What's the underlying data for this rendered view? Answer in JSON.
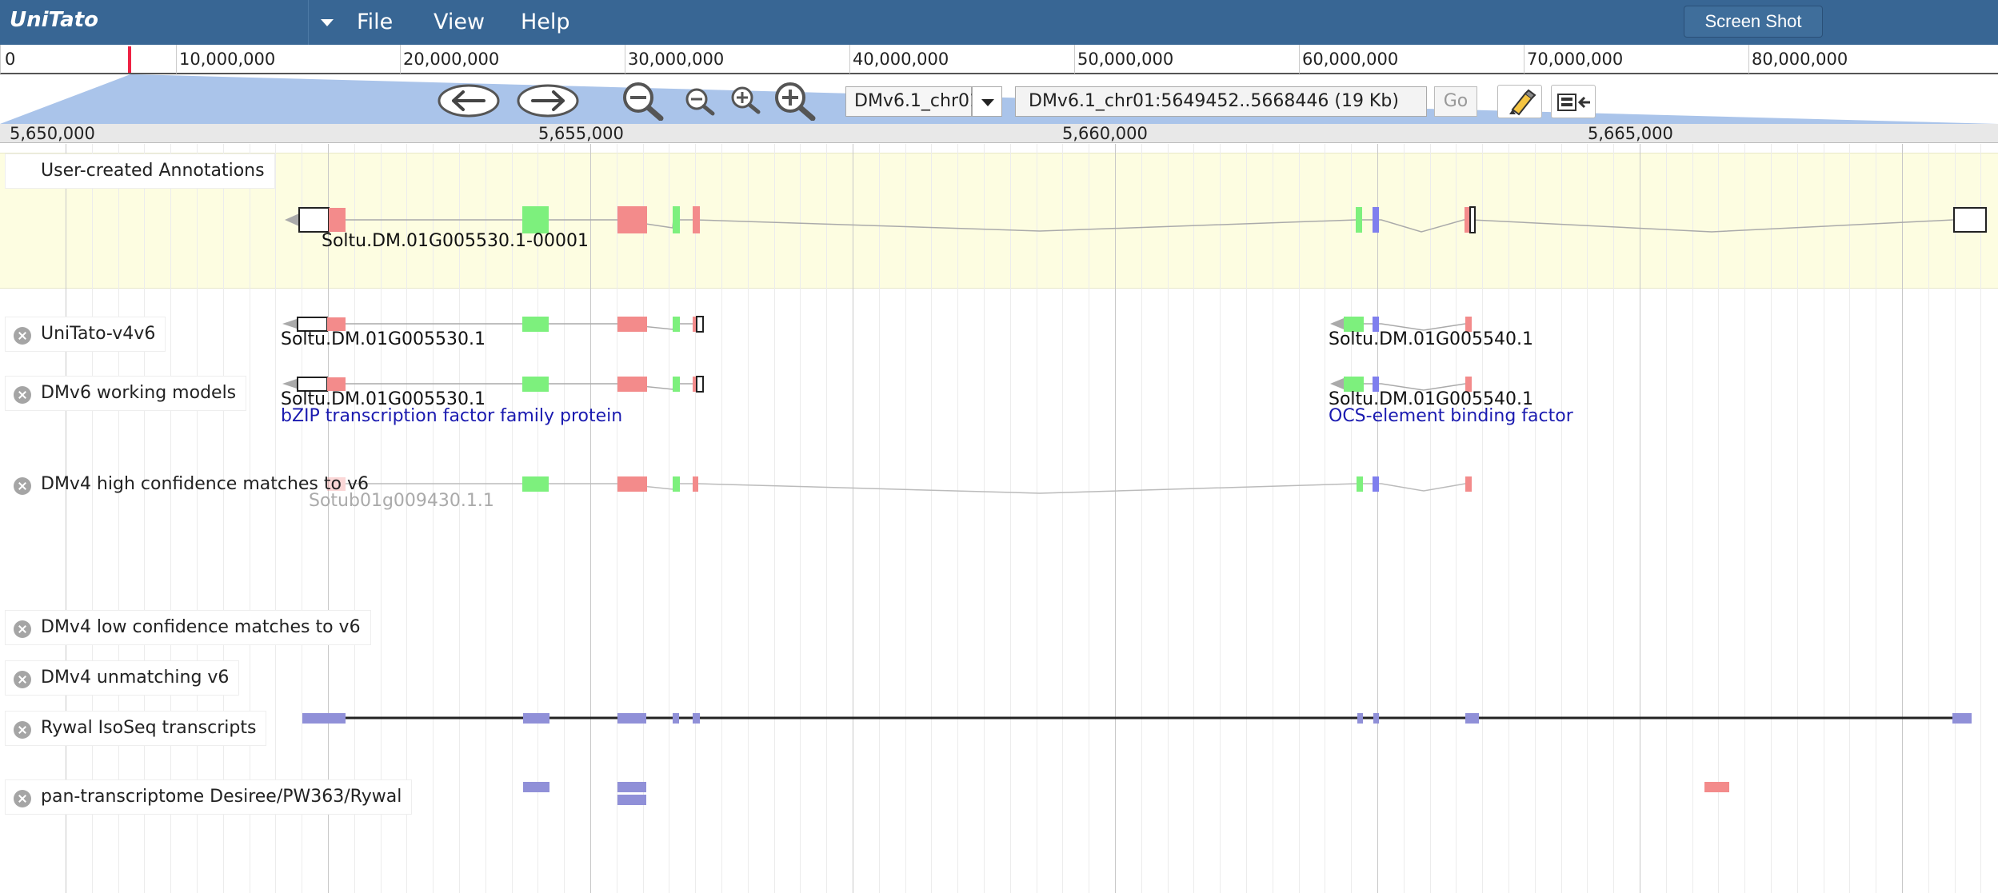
{
  "app": {
    "title": "UniTato"
  },
  "menu": {
    "file": "File",
    "view": "View",
    "help": "Help",
    "screenshot": "Screen Shot"
  },
  "overview": {
    "ticks": [
      "0",
      "10,000,000",
      "20,000,000",
      "30,000,000",
      "40,000,000",
      "50,000,000",
      "60,000,000",
      "70,000,000",
      "80,000,000"
    ]
  },
  "navigation": {
    "chromosome": "DMv6.1_chr01",
    "location": "DMv6.1_chr01:5649452..5668446 (19 Kb)",
    "go": "Go"
  },
  "ruler": {
    "ticks": [
      "5,650,000",
      "5,655,000",
      "5,660,000",
      "5,665,000"
    ]
  },
  "tracks": {
    "annotations": "User-created Annotations",
    "unitato": "UniTato-v4v6",
    "dmv6": "DMv6 working models",
    "dmv4_high": "DMv4 high confidence matches to v6",
    "dmv4_low": "DMv4 low confidence matches to v6",
    "dmv4_unmatch": "DMv4 unmatching v6",
    "rywal": "Rywal IsoSeq transcripts",
    "pan": "pan-transcriptome Desiree/PW363/Rywal"
  },
  "features": {
    "annot_gene": "Soltu.DM.01G005530.1-00001",
    "unitato_gene1": "Soltu.DM.01G005530.1",
    "unitato_gene2": "Soltu.DM.01G005540.1",
    "dmv6_gene1": "Soltu.DM.01G005530.1",
    "dmv6_desc1": "bZIP transcription factor family protein",
    "dmv6_gene2": "Soltu.DM.01G005540.1",
    "dmv6_desc2": "OCS-element binding factor",
    "dmv4_gene": "Sotub01g009430.1.1"
  },
  "colors": {
    "header": "#386694",
    "cds_red": "#f38b8b",
    "cds_green": "#7df07d",
    "cds_blue": "#7f7fee",
    "utr": "#ffffff",
    "isoseq": "#9090d8",
    "annotation_bg": "#fdfde1"
  },
  "icons": {
    "back": "arrow-left-icon",
    "forward": "arrow-right-icon",
    "zoom_out_big": "zoom-out-big-icon",
    "zoom_out_small": "zoom-out-small-icon",
    "zoom_in_small": "zoom-in-small-icon",
    "zoom_in_big": "zoom-in-big-icon",
    "highlight": "highlighter-icon",
    "minimize": "minimize-tracks-icon",
    "close": "close-icon"
  }
}
